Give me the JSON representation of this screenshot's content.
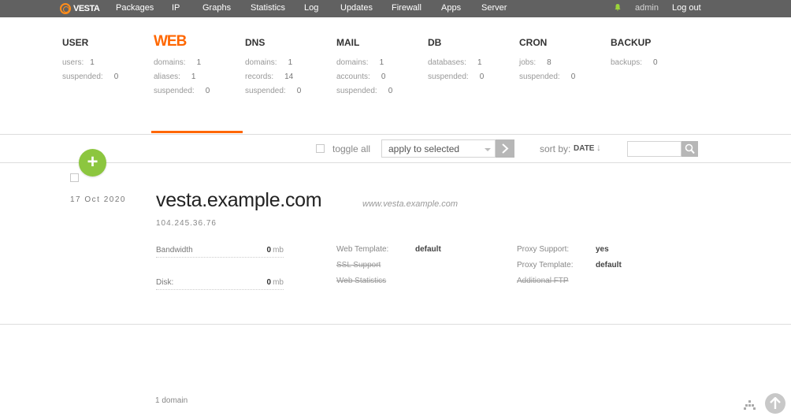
{
  "brand": {
    "name": "VESTA",
    "accent": "#ff6701"
  },
  "nav": {
    "items": [
      "Packages",
      "IP",
      "Graphs",
      "Statistics",
      "Log",
      "Updates",
      "Firewall",
      "Apps",
      "Server"
    ],
    "notifications_icon": "bell-icon",
    "user": "admin",
    "logout": "Log out"
  },
  "stats": [
    {
      "title": "USER",
      "rows": [
        {
          "label": "users:",
          "value": "1"
        },
        {
          "label": "suspended:",
          "value": "0"
        }
      ]
    },
    {
      "title": "WEB",
      "active": true,
      "rows": [
        {
          "label": "domains:",
          "value": "1"
        },
        {
          "label": "aliases:",
          "value": "1"
        },
        {
          "label": "suspended:",
          "value": "0"
        }
      ]
    },
    {
      "title": "DNS",
      "rows": [
        {
          "label": "domains:",
          "value": "1"
        },
        {
          "label": "records:",
          "value": "14"
        },
        {
          "label": "suspended:",
          "value": "0"
        }
      ]
    },
    {
      "title": "MAIL",
      "rows": [
        {
          "label": "domains:",
          "value": "1"
        },
        {
          "label": "accounts:",
          "value": "0"
        },
        {
          "label": "suspended:",
          "value": "0"
        }
      ]
    },
    {
      "title": "DB",
      "rows": [
        {
          "label": "databases:",
          "value": "1"
        },
        {
          "label": "suspended:",
          "value": "0"
        }
      ]
    },
    {
      "title": "CRON",
      "rows": [
        {
          "label": "jobs:",
          "value": "8"
        },
        {
          "label": "suspended:",
          "value": "0"
        }
      ]
    },
    {
      "title": "BACKUP",
      "rows": [
        {
          "label": "backups:",
          "value": "0"
        }
      ]
    }
  ],
  "toolbar": {
    "toggle_all": "toggle all",
    "apply_select": "apply to selected",
    "sort_label": "sort by:",
    "sort_value": "DATE",
    "sort_arrow": "↓",
    "search_value": ""
  },
  "add_button": "+",
  "domain": {
    "date": "17  Oct  2020",
    "name": "vesta.example.com",
    "alias": "www.vesta.example.com",
    "ip": "104.245.36.76",
    "bandwidth": {
      "label": "Bandwidth",
      "value": "0",
      "unit": "mb"
    },
    "disk": {
      "label": "Disk:",
      "value": "0",
      "unit": "mb"
    },
    "web_template": {
      "label": "Web Template:",
      "value": "default"
    },
    "ssl_support": "SSL Support",
    "web_statistics": "Web Statistics",
    "proxy_support": {
      "label": "Proxy Support:",
      "value": "yes"
    },
    "proxy_template": {
      "label": "Proxy Template:",
      "value": "default"
    },
    "additional_ftp": "Additional FTP"
  },
  "footer": {
    "count": "1 domain"
  }
}
